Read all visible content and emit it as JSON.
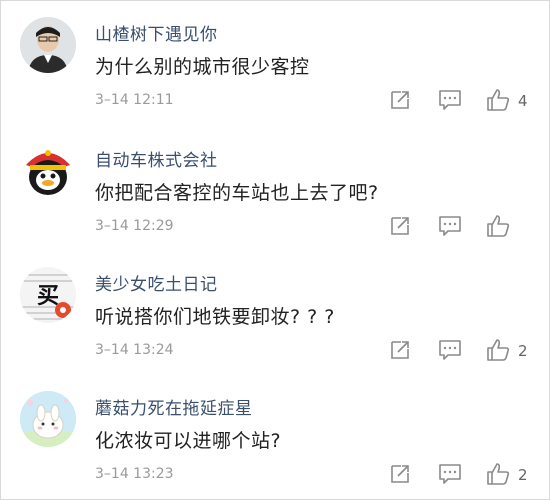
{
  "comments": [
    {
      "username": "山楂树下遇见你",
      "text": "为什么别的城市很少客控",
      "time": "3–14 12:11",
      "likes": "4"
    },
    {
      "username": "自动车株式会社",
      "text": "你把配合客控的车站也上去了吧?",
      "time": "3–14 12:29",
      "likes": ""
    },
    {
      "username": "美少女吃土日记",
      "text": "听说搭你们地铁要卸妆? ? ?",
      "time": "3–14 13:24",
      "likes": "2",
      "avatar_text": "买"
    },
    {
      "username": "蘑菇力死在拖延症星",
      "text": "化浓妆可以进哪个站?",
      "time": "3–14 13:23",
      "likes": "2"
    }
  ],
  "icons": {
    "repost": "repost-icon",
    "reply": "reply-icon",
    "like": "thumbs-up-icon"
  },
  "colors": {
    "username": "#3a4f6e",
    "text": "#222222",
    "time": "#9a9a9a",
    "icon": "#8a8a8a"
  }
}
